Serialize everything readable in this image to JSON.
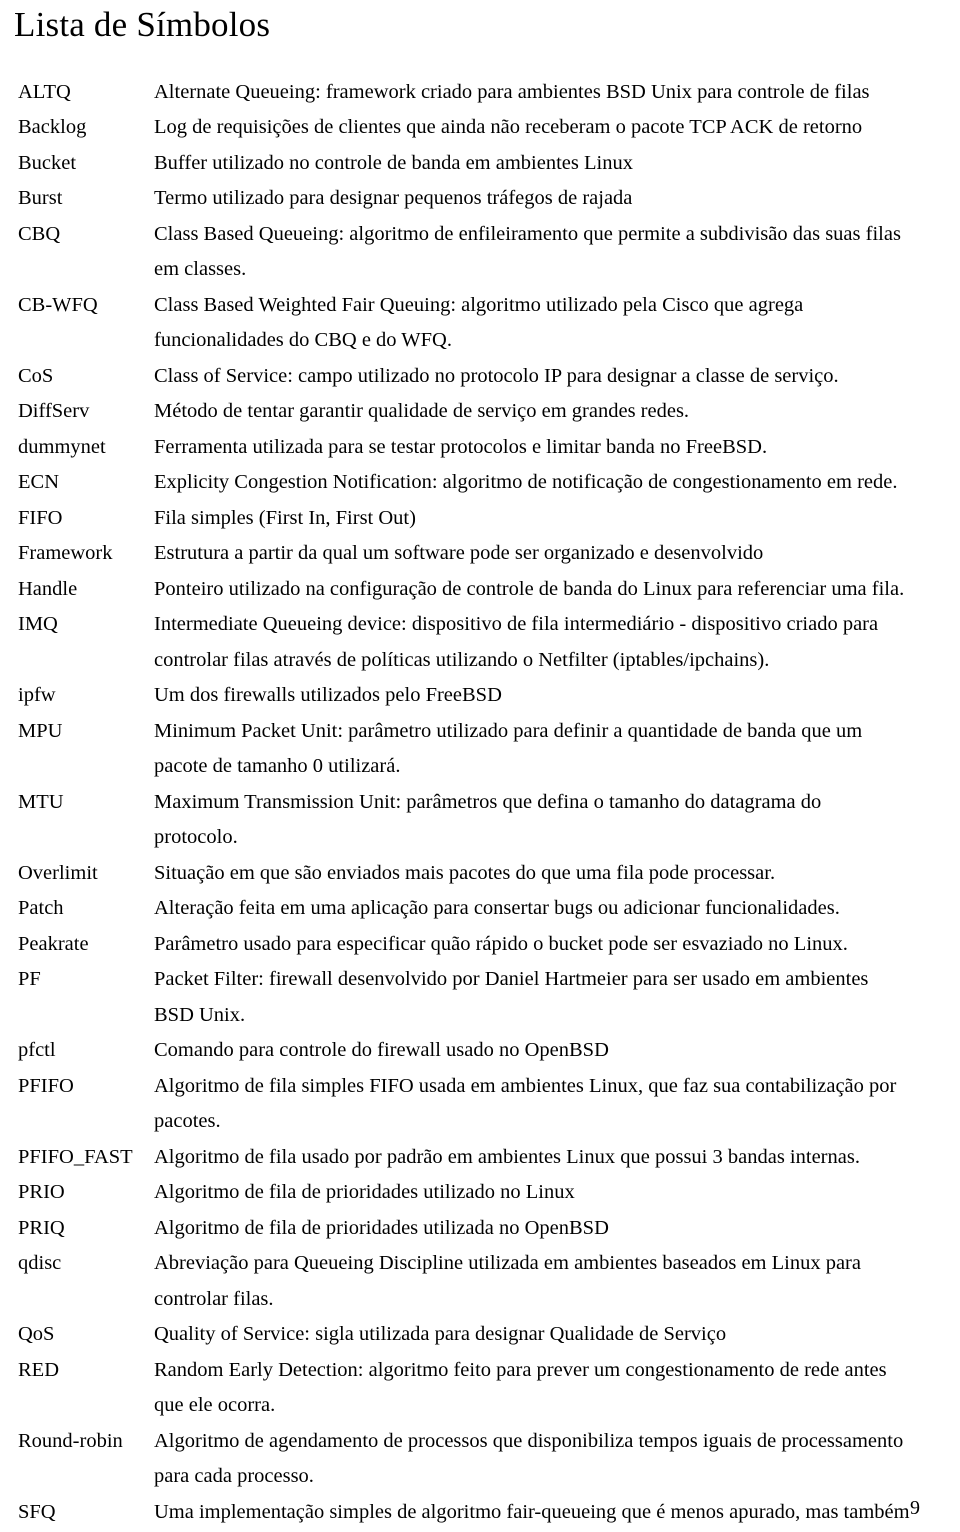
{
  "document": {
    "title": "Lista de Símbolos",
    "page_number": "9",
    "entries": [
      {
        "term": "ALTQ",
        "definition": "Alternate Queueing: framework criado para ambientes BSD Unix para controle de filas"
      },
      {
        "term": "Backlog",
        "definition": "Log de requisições de clientes que ainda não receberam o pacote TCP ACK de retorno"
      },
      {
        "term": "Bucket",
        "definition": "Buffer utilizado no controle de banda em ambientes Linux"
      },
      {
        "term": "Burst",
        "definition": "Termo utilizado para designar pequenos tráfegos de rajada"
      },
      {
        "term": "CBQ",
        "definition": "Class Based Queueing: algoritmo de enfileiramento que permite a subdivisão das suas filas em classes."
      },
      {
        "term": "CB-WFQ",
        "definition": "Class Based Weighted Fair Queuing: algoritmo utilizado pela Cisco que agrega funcionalidades do CBQ e do WFQ."
      },
      {
        "term": "CoS",
        "definition": "Class of Service: campo utilizado no protocolo IP para designar a classe de serviço."
      },
      {
        "term": "DiffServ",
        "definition": "Método de tentar garantir qualidade de serviço em grandes redes."
      },
      {
        "term": "dummynet",
        "definition": "Ferramenta utilizada para se testar protocolos e limitar banda no FreeBSD."
      },
      {
        "term": "ECN",
        "definition": "Explicity Congestion Notification: algoritmo de notificação de congestionamento em rede."
      },
      {
        "term": "FIFO",
        "definition": "Fila simples (First In, First Out)"
      },
      {
        "term": "Framework",
        "definition": "Estrutura a partir da qual um software pode ser organizado e desenvolvido"
      },
      {
        "term": "Handle",
        "definition": "Ponteiro utilizado na configuração de controle de banda do Linux para referenciar uma fila."
      },
      {
        "term": "IMQ",
        "definition": "Intermediate Queueing device: dispositivo de fila intermediário - dispositivo criado para controlar filas através de políticas utilizando o Netfilter (iptables/ipchains)."
      },
      {
        "term": "ipfw",
        "definition": "Um dos firewalls utilizados pelo FreeBSD"
      },
      {
        "term": "MPU",
        "definition": "Minimum Packet Unit: parâmetro utilizado para definir a quantidade de banda que um pacote de tamanho 0 utilizará."
      },
      {
        "term": "MTU",
        "definition": "Maximum Transmission Unit: parâmetros que defina o tamanho do datagrama do protocolo."
      },
      {
        "term": "Overlimit",
        "definition": "Situação em que são enviados mais pacotes do que uma fila pode processar."
      },
      {
        "term": "Patch",
        "definition": "Alteração feita em uma aplicação para consertar bugs ou adicionar funcionalidades."
      },
      {
        "term": "Peakrate",
        "definition": "Parâmetro usado para especificar quão rápido o bucket pode ser esvaziado no Linux."
      },
      {
        "term": "PF",
        "definition": "Packet Filter: firewall desenvolvido por Daniel Hartmeier para ser usado em ambientes BSD Unix."
      },
      {
        "term": "pfctl",
        "definition": "Comando para controle do firewall usado no OpenBSD"
      },
      {
        "term": "PFIFO",
        "definition": "Algoritmo de fila simples FIFO usada em ambientes Linux, que faz sua contabilização por pacotes."
      },
      {
        "term": "PFIFO_FAST",
        "definition": "Algoritmo de fila usado por padrão em ambientes Linux que possui 3 bandas internas."
      },
      {
        "term": "PRIO",
        "definition": "Algoritmo de fila de prioridades utilizado no Linux"
      },
      {
        "term": "PRIQ",
        "definition": "Algoritmo de fila de prioridades utilizada no OpenBSD"
      },
      {
        "term": "qdisc",
        "definition": "Abreviação para Queueing Discipline utilizada em ambientes baseados em Linux para controlar filas."
      },
      {
        "term": "QoS",
        "definition": "Quality of Service: sigla utilizada para designar Qualidade de Serviço"
      },
      {
        "term": "RED",
        "definition": "Random Early Detection: algoritmo feito para prever um congestionamento de rede antes que ele ocorra."
      },
      {
        "term": "Round-robin",
        "definition": "Algoritmo de agendamento de processos que disponibiliza tempos iguais de processamento para cada processo."
      },
      {
        "term": "SFQ",
        "definition": "Uma implementação simples de algoritmo fair-queueing que é menos apurado, mas também"
      }
    ]
  }
}
